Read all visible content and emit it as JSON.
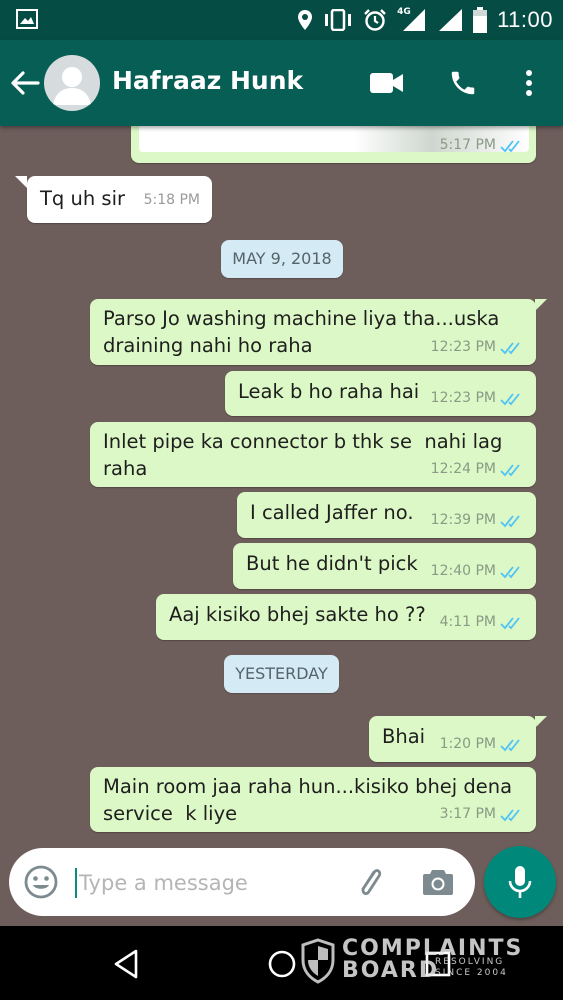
{
  "status_bar": {
    "time": "11:00",
    "network": "4G",
    "icons": [
      "image-icon",
      "location-icon",
      "vibrate-icon",
      "alarm-icon",
      "signal-icon",
      "signal-icon",
      "battery-icon"
    ]
  },
  "header": {
    "contact_name": "Hafraaz Hunk",
    "icons": [
      "back-arrow-icon",
      "avatar-icon",
      "video-call-icon",
      "phone-icon",
      "more-vert-icon"
    ]
  },
  "messages": [
    {
      "dir": "out",
      "text": "",
      "time": "5:17 PM",
      "status": "read"
    },
    {
      "dir": "in",
      "text": "Tq uh sir",
      "time": "5:18 PM"
    },
    {
      "dir": "date",
      "text": "MAY 9, 2018"
    },
    {
      "dir": "out",
      "text": "Parso Jo washing machine liya tha...uska\ndraining nahi ho raha",
      "time": "12:23 PM",
      "status": "read"
    },
    {
      "dir": "out",
      "text": "Leak b ho raha hai",
      "time": "12:23 PM",
      "status": "read"
    },
    {
      "dir": "out",
      "text": "Inlet pipe ka connector b thk se  nahi lag\nraha",
      "time": "12:24 PM",
      "status": "read"
    },
    {
      "dir": "out",
      "text": "I called Jaffer no.",
      "time": "12:39 PM",
      "status": "read"
    },
    {
      "dir": "out",
      "text": "But he didn't pick",
      "time": "12:40 PM",
      "status": "read"
    },
    {
      "dir": "out",
      "text": "Aaj kisiko bhej sakte ho ??",
      "time": "4:11 PM",
      "status": "read"
    },
    {
      "dir": "date",
      "text": "YESTERDAY"
    },
    {
      "dir": "out",
      "text": "Bhai",
      "time": "1:20 PM",
      "status": "read"
    },
    {
      "dir": "out",
      "text": "Main room jaa raha hun...kisiko bhej dena\nservice  k liye",
      "time": "3:17 PM",
      "status": "read"
    }
  ],
  "composer": {
    "placeholder": "Type a message",
    "value": ""
  },
  "colors": {
    "header": "#075e54",
    "status_bar": "#054d44",
    "chat_background": "#6e5e5b",
    "outgoing_bubble": "#dcf8c6",
    "incoming_bubble": "#ffffff",
    "read_ticks": "#4fc3f7",
    "mic_button": "#00897b"
  },
  "watermark": {
    "line1": "COMPLAINTS",
    "line2": "BOARD",
    "tagline": "RESOLVING\nSINCE 2004"
  }
}
